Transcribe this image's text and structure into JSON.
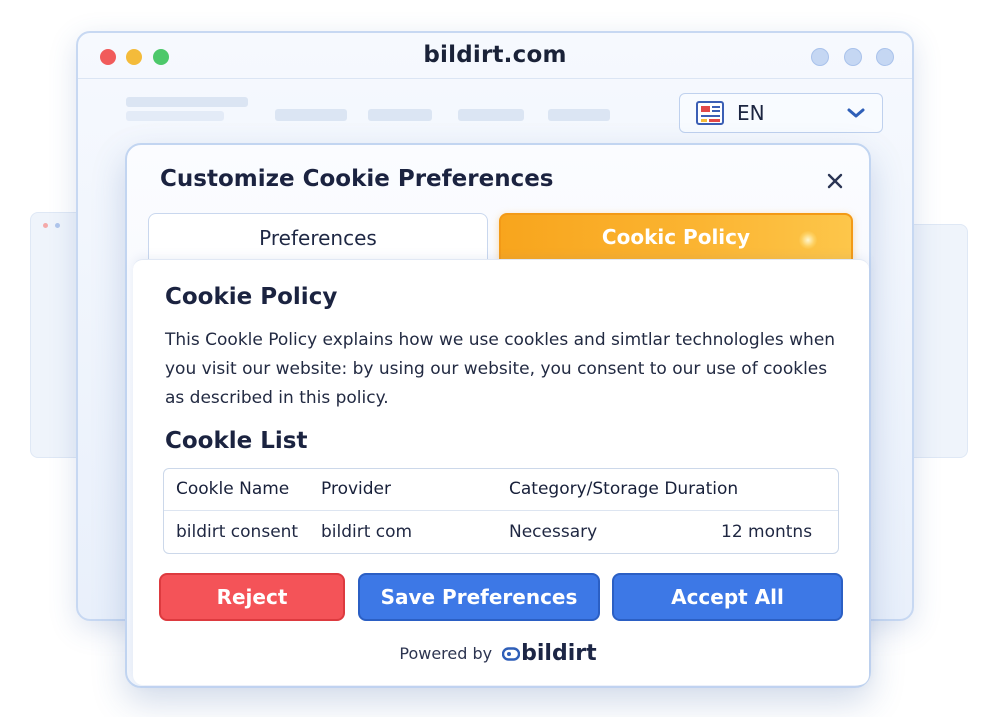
{
  "browser": {
    "site_title": "bildirt.com",
    "language": {
      "code": "EN"
    }
  },
  "modal": {
    "title": "Customize Cookie Preferences",
    "tabs": [
      {
        "label": "Preferences",
        "active": false
      },
      {
        "label": "Cookic Policy",
        "active": true
      }
    ],
    "policy": {
      "heading": "Cookie Policy",
      "description": "This Cookle Policy explains how we use cookles and simtlar technologles when you visit our website: by using our website, you consent to our use of cookles as described in this policy.",
      "list_heading": "Cookle List",
      "table": {
        "headers": [
          "Cookle Name",
          "Provider",
          "Category/Storage",
          "Duration"
        ],
        "rows": [
          [
            "bildirt consent",
            "bildirt com",
            "Necessary",
            "12 montns"
          ]
        ]
      }
    },
    "buttons": {
      "reject": "Reject",
      "save": "Save Preferences",
      "accept": "Accept All"
    },
    "footer": {
      "powered_by": "Powered by",
      "brand": "bildirt"
    }
  },
  "colors": {
    "active_tab": "#fbb431",
    "reject": "#f45358",
    "primary": "#3d78e6"
  },
  "icons": [
    "close-icon",
    "chevron-down-icon",
    "flag-icon",
    "bildirt-logo-icon"
  ]
}
